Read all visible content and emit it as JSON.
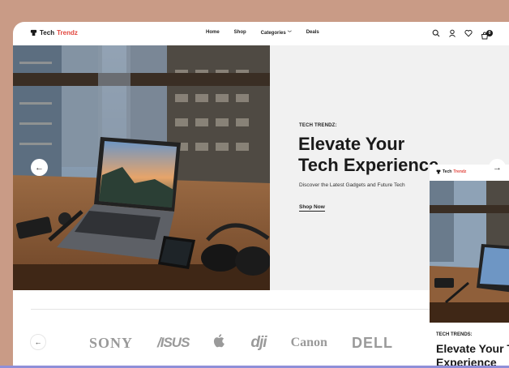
{
  "brand": {
    "name_part1": "Tech",
    "name_part2": "Trendz",
    "accent_color": "#e2463e"
  },
  "nav": {
    "items": [
      {
        "label": "Home"
      },
      {
        "label": "Shop"
      },
      {
        "label": "Categories"
      },
      {
        "label": "Deals"
      }
    ],
    "icons": [
      "search-icon",
      "user-icon",
      "heart-icon",
      "cart-icon"
    ],
    "cart_count": "0"
  },
  "hero": {
    "eyebrow": "TECH TRENDZ:",
    "headline_line1": "Elevate Your",
    "headline_line2": "Tech Experience",
    "subline": "Discover the Latest Gadgets and Future Tech",
    "cta": "Shop Now"
  },
  "brands": {
    "items": [
      {
        "name": "SONY"
      },
      {
        "name": "/ISUS"
      },
      {
        "name": "apple"
      },
      {
        "name": "dji"
      },
      {
        "name": "Canon"
      },
      {
        "name": "DELL"
      }
    ]
  },
  "preview": {
    "logo_part1": "Tech",
    "logo_part2": "Trendz",
    "eyebrow": "TECH TRENDS:",
    "headline_line1": "Elevate Your T",
    "headline_line2": "Experience"
  }
}
